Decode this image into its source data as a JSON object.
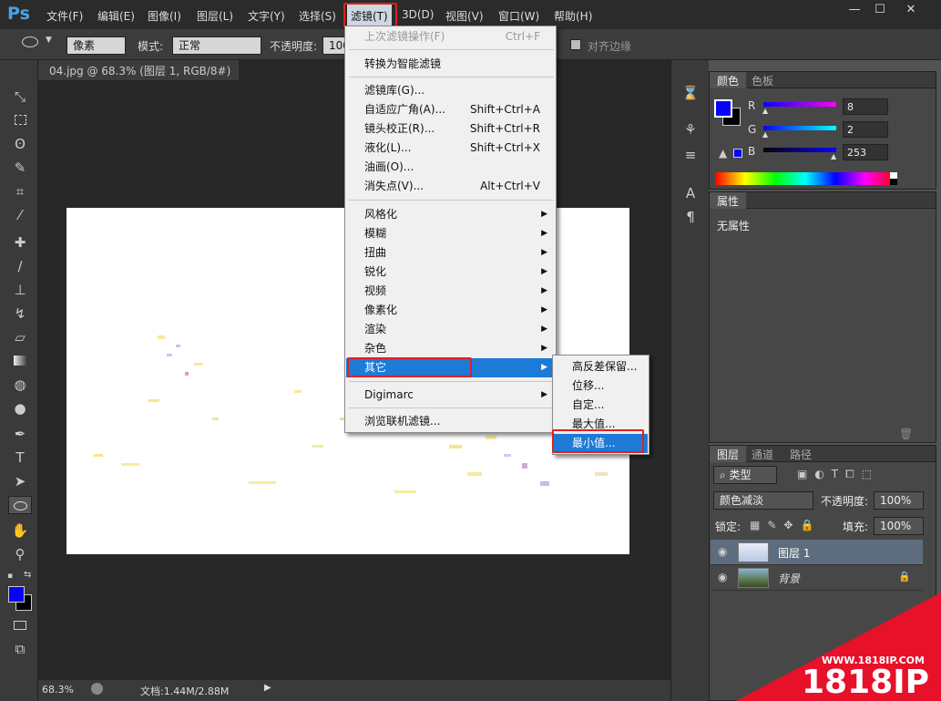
{
  "app": {
    "logo": "Ps"
  },
  "menubar": {
    "items": [
      "文件(F)",
      "编辑(E)",
      "图像(I)",
      "图层(L)",
      "文字(Y)",
      "选择(S)",
      "滤镜(T)",
      "3D(D)",
      "视图(V)",
      "窗口(W)",
      "帮助(H)"
    ],
    "active": "滤镜(T)"
  },
  "window_controls": {
    "minimize": "—",
    "restore": "☐",
    "close": "✕"
  },
  "options_bar": {
    "unit": "像素",
    "mode_label": "模式:",
    "mode_value": "正常",
    "opacity_label": "不透明度:",
    "opacity_value": "100%",
    "align_edges": "对齐边缘"
  },
  "document": {
    "tab_title": "04.jpg @ 68.3% (图层 1, RGB/8#) *",
    "tab_close": "×"
  },
  "status": {
    "zoom": "68.3%",
    "doc_info": "文档:1.44M/2.88M"
  },
  "filter_menu": {
    "last_filter": "上次滤镜操作(F)",
    "last_filter_shortcut": "Ctrl+F",
    "smart": "转换为智能滤镜",
    "gallery": "滤镜库(G)...",
    "adaptive": "自适应广角(A)...",
    "adaptive_shortcut": "Shift+Ctrl+A",
    "lens": "镜头校正(R)...",
    "lens_shortcut": "Shift+Ctrl+R",
    "liquify": "液化(L)...",
    "liquify_shortcut": "Shift+Ctrl+X",
    "oil": "油画(O)...",
    "vanish": "消失点(V)...",
    "vanish_shortcut": "Alt+Ctrl+V",
    "stylize": "风格化",
    "blur": "模糊",
    "distort": "扭曲",
    "sharpen": "锐化",
    "video": "视频",
    "pixelate": "像素化",
    "render": "渲染",
    "noise": "杂色",
    "other": "其它",
    "digimarc": "Digimarc",
    "browse": "浏览联机滤镜..."
  },
  "other_submenu": {
    "high_pass": "高反差保留...",
    "offset": "位移...",
    "custom": "自定...",
    "maximum": "最大值...",
    "minimum": "最小值..."
  },
  "color_panel": {
    "tab_color": "颜色",
    "tab_swatches": "色板",
    "r_label": "R",
    "r_value": "8",
    "g_label": "G",
    "g_value": "2",
    "b_label": "B",
    "b_value": "253",
    "foreground": "#0802fd"
  },
  "properties_panel": {
    "title": "属性",
    "empty": "无属性"
  },
  "layers_panel": {
    "tabs": [
      "图层",
      "通道",
      "路径"
    ],
    "filter_kind": "类型",
    "blend_mode": "颜色减淡",
    "opacity_label": "不透明度:",
    "opacity_value": "100%",
    "lock_label": "锁定:",
    "fill_label": "填充:",
    "fill_value": "100%",
    "layers": [
      "图层 1",
      "背景"
    ]
  },
  "watermark": {
    "url": "WWW.1818IP.COM",
    "brand": "1818IP"
  }
}
